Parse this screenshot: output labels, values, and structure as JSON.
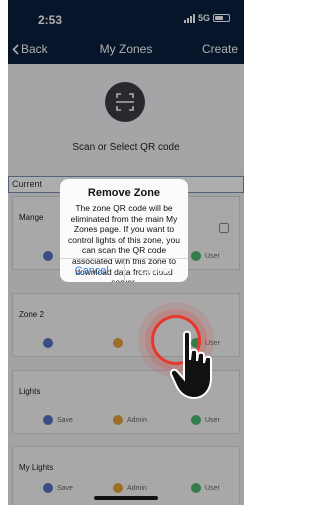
{
  "status_bar": {
    "time": "2:53",
    "network": "5G"
  },
  "nav": {
    "back_label": "Back",
    "title": "My Zones",
    "create_label": "Create"
  },
  "scan": {
    "label": "Scan or Select QR code",
    "icon": "qr-scan-icon"
  },
  "current_label": "Current",
  "zones": [
    {
      "name": "Mange",
      "buttons": [
        "",
        "",
        "User"
      ]
    },
    {
      "name": "Zone 2",
      "buttons": [
        "",
        "",
        "User"
      ]
    },
    {
      "name": "Lights",
      "buttons": [
        "Save",
        "Admin",
        "User"
      ]
    },
    {
      "name": "My Lights",
      "buttons": [
        "Save",
        "Admin",
        "User"
      ]
    }
  ],
  "zone_button_colors": {
    "save": "#5b6fc8",
    "admin": "#e6a23c",
    "user": "#4cb86b"
  },
  "dialog": {
    "title": "Remove Zone",
    "message": "The zone QR code will be eliminated from the main My Zones page. If you want to control lights of this zone, you can scan the QR code associated with this zone to download data from cloud server.",
    "cancel_label": "Cancel",
    "delete_label": "Delete"
  },
  "colors": {
    "header": "#0b1f3f",
    "accent": "#2b78e4",
    "highlight": "#e7372f"
  }
}
